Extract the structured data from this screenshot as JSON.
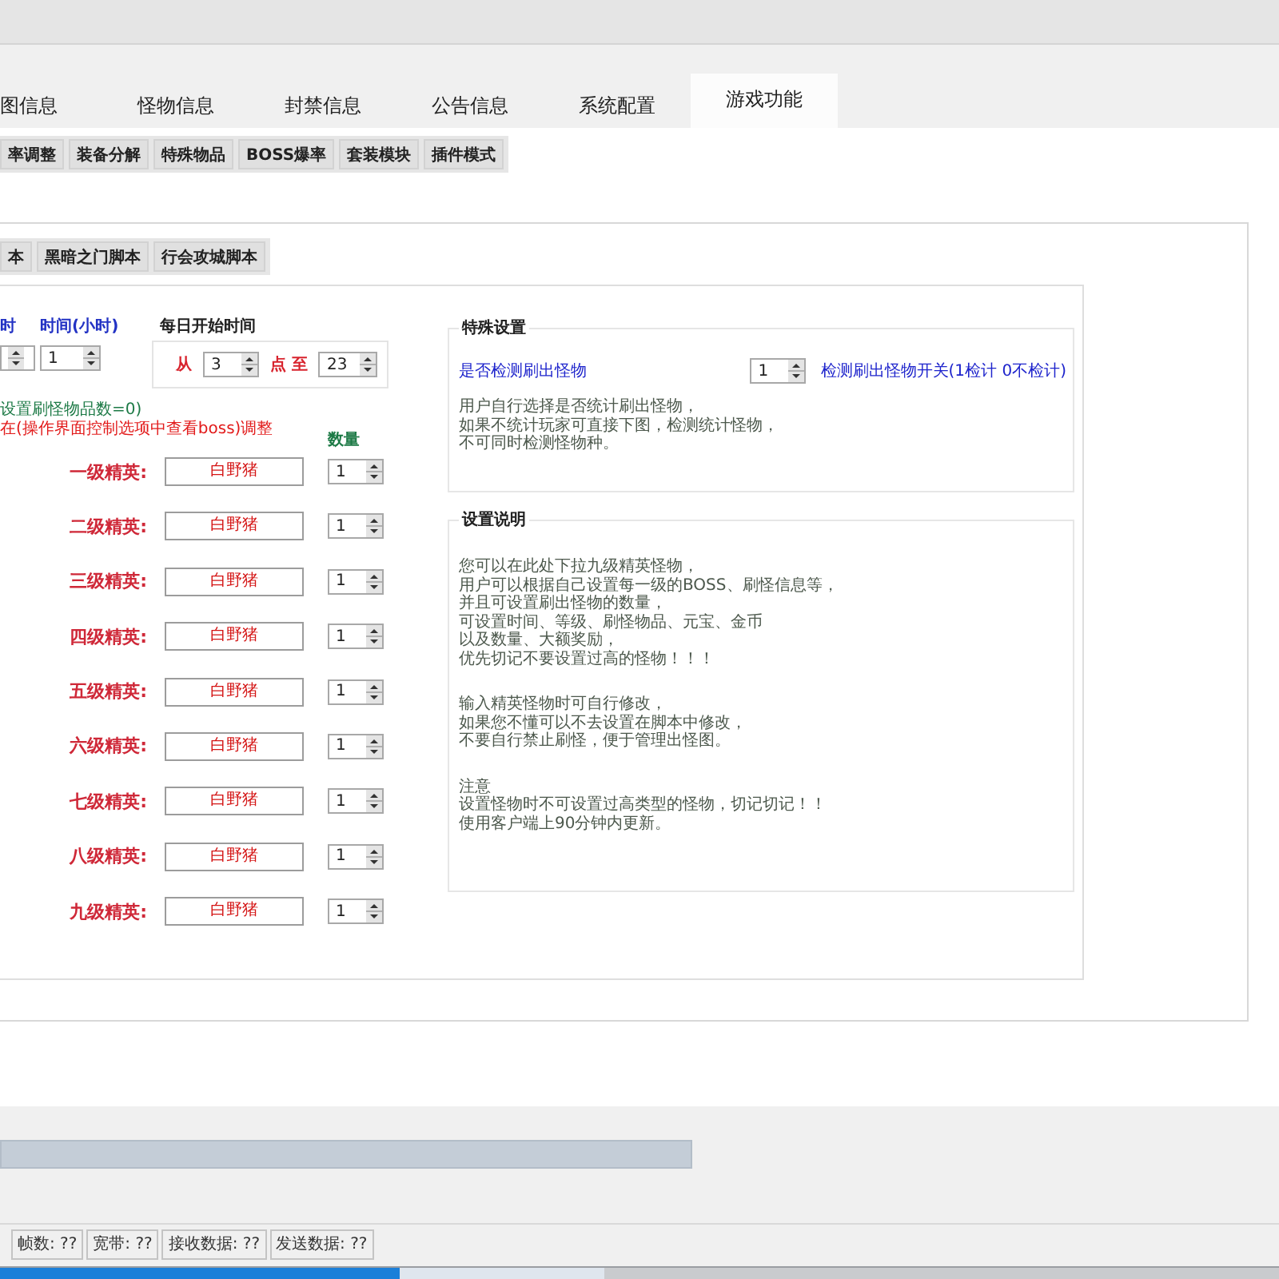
{
  "main_tabs": [
    {
      "label": "图信息",
      "selected": false
    },
    {
      "label": "怪物信息",
      "selected": false
    },
    {
      "label": "封禁信息",
      "selected": false
    },
    {
      "label": "公告信息",
      "selected": false
    },
    {
      "label": "系统配置",
      "selected": false
    },
    {
      "label": "游戏功能",
      "selected": true
    }
  ],
  "sub_tabs": [
    {
      "label": "率调整"
    },
    {
      "label": "装备分解"
    },
    {
      "label": "特殊物品"
    },
    {
      "label": "BOSS爆率"
    },
    {
      "label": "套装模块"
    },
    {
      "label": "插件模式"
    }
  ],
  "script_tabs": [
    {
      "label": "本"
    },
    {
      "label": "黑暗之门脚本"
    },
    {
      "label": "行会攻城脚本"
    }
  ],
  "schedule": {
    "intervals": [
      {
        "label": "时"
      },
      {
        "label": "时间(小时)",
        "value": "1"
      }
    ],
    "daily_start": {
      "title": "每日开始时间",
      "from_label": "从",
      "from_value": "3",
      "to_label": "点 至",
      "to_value": "23"
    }
  },
  "elite": {
    "note": "设置刷怪物品数=0)",
    "warning": "在(操作界面控制选项中查看boss)调整",
    "count_header": "数量",
    "rows": [
      {
        "label": "一级精英:",
        "monster": "白野猪",
        "count": "1"
      },
      {
        "label": "二级精英:",
        "monster": "白野猪",
        "count": "1"
      },
      {
        "label": "三级精英:",
        "monster": "白野猪",
        "count": "1"
      },
      {
        "label": "四级精英:",
        "monster": "白野猪",
        "count": "1"
      },
      {
        "label": "五级精英:",
        "monster": "白野猪",
        "count": "1"
      },
      {
        "label": "六级精英:",
        "monster": "白野猪",
        "count": "1"
      },
      {
        "label": "七级精英:",
        "monster": "白野猪",
        "count": "1"
      },
      {
        "label": "八级精英:",
        "monster": "白野猪",
        "count": "1"
      },
      {
        "label": "九级精英:",
        "monster": "白野猪",
        "count": "1"
      }
    ]
  },
  "special_settings": {
    "title": "特殊设置",
    "label": "是否检测刷出怪物",
    "value": "1",
    "hint": "检测刷出怪物开关(1检计 0不检计)",
    "notes": [
      "用户自行选择是否统计刷出怪物，",
      "如果不统计玩家可直接下图，检测统计怪物，",
      "不可同时检测怪物种。"
    ]
  },
  "instructions": {
    "title": "设置说明",
    "paragraphs": [
      [
        "您可以在此处下拉九级精英怪物，",
        "用户可以根据自己设置每一级的BOSS、刷怪信息等，",
        "并且可设置刷出怪物的数量，",
        "可设置时间、等级、刷怪物品、元宝、金币",
        "以及数量、大额奖励，",
        "优先切记不要设置过高的怪物！！！"
      ],
      [
        "输入精英怪物时可自行修改，",
        "如果您不懂可以不去设置在脚本中修改，",
        "不要自行禁止刷怪，便于管理出怪图。"
      ],
      [
        "注意",
        "设置怪物时不可设置过高类型的怪物，切记切记！！",
        "使用客户端上90分钟内更新。"
      ]
    ]
  },
  "progress": {
    "level": 1
  },
  "status_bar": [
    "帧数: ??",
    "宽带: ??",
    "接收数据: ??",
    "发送数据: ??"
  ]
}
